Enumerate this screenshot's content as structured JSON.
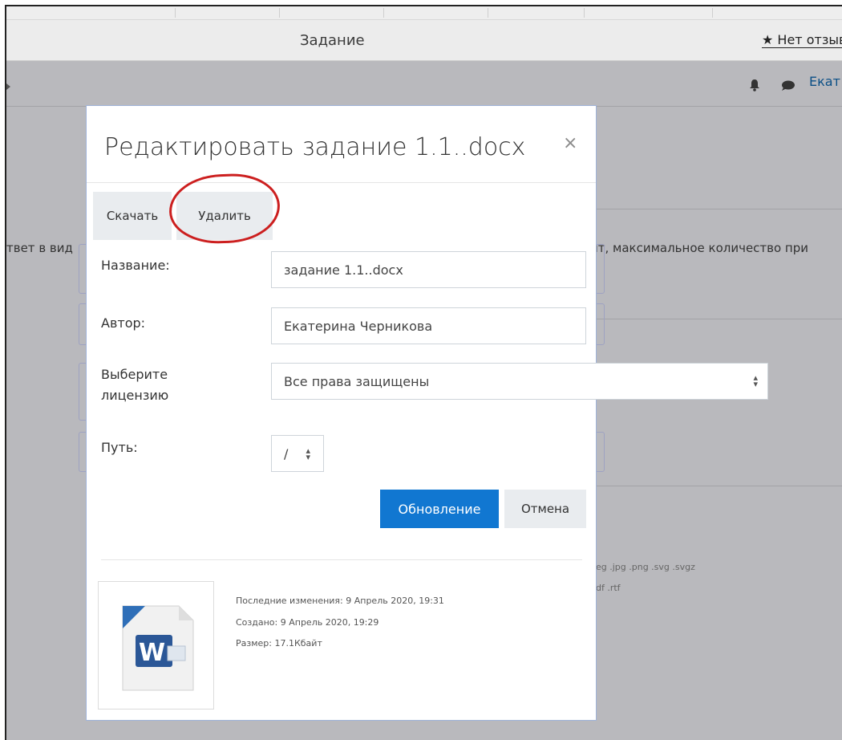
{
  "browser": {
    "page_title": "Задание",
    "feedback_link": "★ Нет отзыв"
  },
  "navbar": {
    "user_name": "Екат"
  },
  "background": {
    "left_text": "твет в вид",
    "right_text": "йт, максимальное количество при",
    "types_line1": "peg .jpg .png .svg .svgz",
    "types_line2": "pdf .rtf"
  },
  "modal": {
    "title": "Редактировать задание 1.1..docx",
    "download_label": "Скачать",
    "delete_label": "Удалить",
    "fields": {
      "name_label": "Название:",
      "name_value": "задание 1.1..docx",
      "author_label": "Автор:",
      "author_value": "Екатерина Черникова",
      "license_label": "Выберите лицензию",
      "license_value": "Все права защищены",
      "path_label": "Путь:",
      "path_value": "/"
    },
    "update_label": "Обновление",
    "cancel_label": "Отмена",
    "file_info": {
      "modified": "Последние изменения:  9 Апрель 2020, 19:31",
      "created": "Создано:  9 Апрель 2020, 19:29",
      "size": "Размер:  17.1Кбайт"
    }
  },
  "colors": {
    "primary": "#1177d1",
    "annotation_red": "#cc1f1f",
    "overlay_gray": "#b9b9bd"
  }
}
